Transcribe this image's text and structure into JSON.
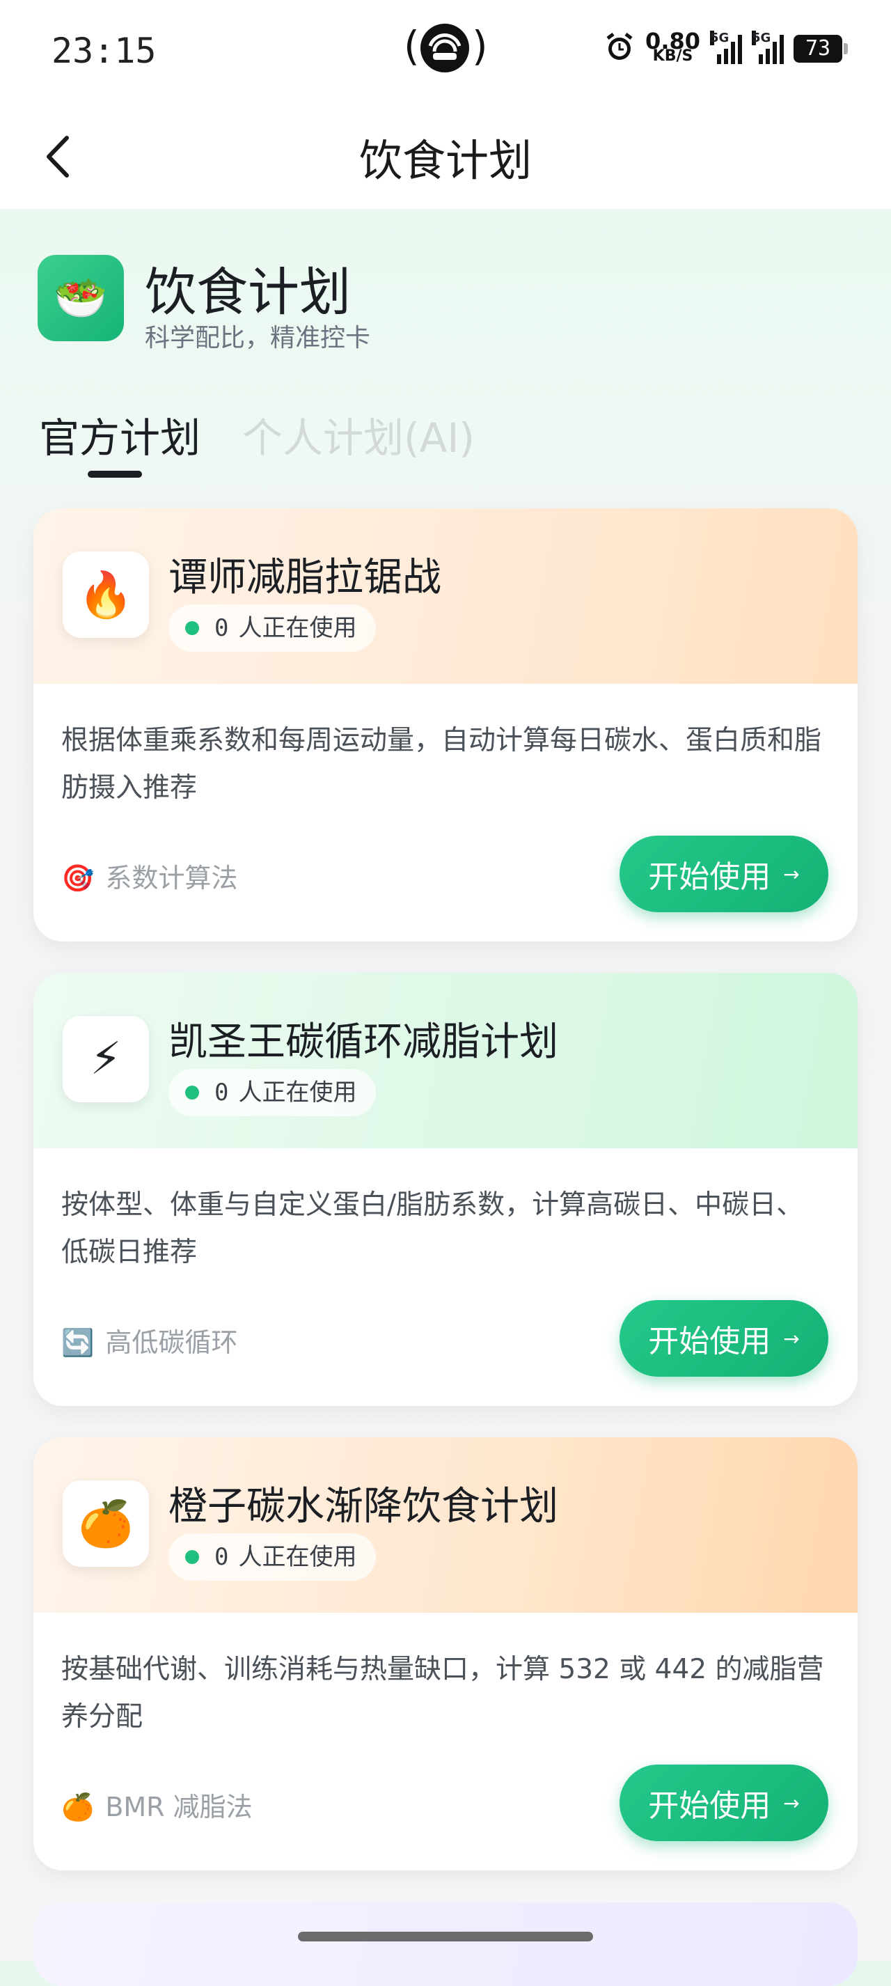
{
  "status_bar": {
    "time": "23:15",
    "net_speed_value": "0.80",
    "net_speed_unit": "KB/S",
    "signal1_label": "5G",
    "signal2_label": "5G",
    "battery": "73"
  },
  "nav": {
    "title": "饮食计划",
    "back_icon": "chevron-left-icon"
  },
  "header": {
    "icon": "salad-icon",
    "icon_glyph": "🥗",
    "title": "饮食计划",
    "subtitle": "科学配比，精准控卡"
  },
  "tabs": [
    {
      "label": "官方计划",
      "active": true
    },
    {
      "label": "个人计划(AI)",
      "active": false
    }
  ],
  "plans": [
    {
      "icon": "fire-icon",
      "icon_glyph": "🔥",
      "title": "谭师减脂拉锯战",
      "users_count": "0",
      "users_label": "人正在使用",
      "description": "根据体重乘系数和每周运动量，自动计算每日碳水、蛋白质和脂肪摄入推荐",
      "tag_icon": "target-icon",
      "tag_glyph": "🎯",
      "tag": "系数计算法",
      "button": "开始使用",
      "button_arrow": "→"
    },
    {
      "icon": "lightning-icon",
      "icon_glyph": "⚡",
      "title": "凯圣王碳循环减脂计划",
      "users_count": "0",
      "users_label": "人正在使用",
      "description": "按体型、体重与自定义蛋白/脂肪系数，计算高碳日、中碳日、低碳日推荐",
      "tag_icon": "cycle-icon",
      "tag_glyph": "🔄",
      "tag": "高低碳循环",
      "button": "开始使用",
      "button_arrow": "→"
    },
    {
      "icon": "orange-icon",
      "icon_glyph": "🍊",
      "title": "橙子碳水渐降饮食计划",
      "users_count": "0",
      "users_label": "人正在使用",
      "description": "按基础代谢、训练消耗与热量缺口，计算 532 或 442 的减脂营养分配",
      "tag_icon": "orange-icon",
      "tag_glyph": "🍊",
      "tag": "BMR 减脂法",
      "button": "开始使用",
      "button_arrow": "→"
    }
  ]
}
